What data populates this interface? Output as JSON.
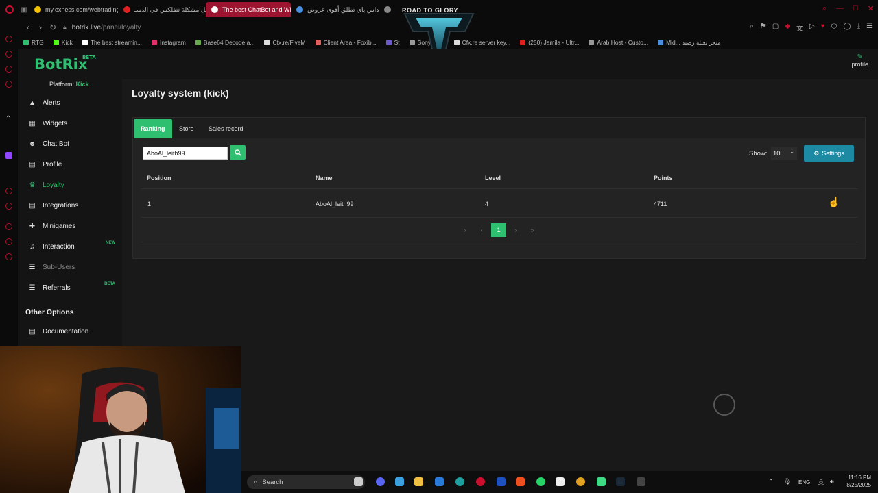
{
  "browser": {
    "tabs": [
      {
        "label": "my.exness.com/webtrading",
        "color": "#f5c400"
      },
      {
        "label": "حل مشكلة تتفلكس في الدسـ",
        "color": "#e02020"
      },
      {
        "label": "The best ChatBot and Wi",
        "color": "#ffffff",
        "active": true
      },
      {
        "label": "ميداس باي تطلق أقوى عروض",
        "color": "#4a90e2"
      },
      {
        "label": "",
        "color": "#888888"
      }
    ],
    "url_domain": "botrix.live",
    "url_path": "/panel/loyalty",
    "bookmarks": [
      {
        "label": "RTG",
        "color": "#2fbf71"
      },
      {
        "label": "Kick",
        "color": "#53fc18"
      },
      {
        "label": "The best streamin...",
        "color": "#ffffff"
      },
      {
        "label": "Instagram",
        "color": "#e1306c"
      },
      {
        "label": "Base64 Decode a...",
        "color": "#6aa84f"
      },
      {
        "label": "Cfx.re/FiveM",
        "color": "#dddddd"
      },
      {
        "label": "Client Area - Foxib...",
        "color": "#e06060"
      },
      {
        "label": "St",
        "color": "#6a5acd"
      },
      {
        "label": "Sony ZV...",
        "color": "#999999"
      },
      {
        "label": "Cfx.re server key...",
        "color": "#dddddd"
      },
      {
        "label": "(250) Jamila - Ultr...",
        "color": "#e02020"
      },
      {
        "label": "Arab Host - Custo...",
        "color": "#999999"
      },
      {
        "label": "Mid... متجر تعبئة رصيد",
        "color": "#4a90e2"
      }
    ]
  },
  "overlay": {
    "tag": "ROAD TO GLORY"
  },
  "app": {
    "logo": "BotRix",
    "logo_badge": "BETA",
    "profile_label": "profile",
    "platform_label": "Platform:",
    "platform_value": "Kick"
  },
  "sidebar": {
    "items": [
      {
        "label": "Alerts",
        "icon": "warning-icon",
        "glyph": "▲"
      },
      {
        "label": "Widgets",
        "icon": "grid-icon",
        "glyph": "▦"
      },
      {
        "label": "Chat Bot",
        "icon": "robot-icon",
        "glyph": "☻"
      },
      {
        "label": "Profile",
        "icon": "id-card-icon",
        "glyph": "▤"
      },
      {
        "label": "Loyalty",
        "icon": "trophy-icon",
        "glyph": "♛",
        "active": true
      },
      {
        "label": "Integrations",
        "icon": "list-icon",
        "glyph": "▤"
      },
      {
        "label": "Minigames",
        "icon": "gamepad-icon",
        "glyph": "✚"
      },
      {
        "label": "Interaction",
        "icon": "music-icon",
        "glyph": "♫",
        "badge": "NEW"
      },
      {
        "label": "Sub-Users",
        "icon": "users-icon",
        "glyph": "☰",
        "disabled": true
      },
      {
        "label": "Referrals",
        "icon": "users-icon",
        "glyph": "☰",
        "badge": "BETA"
      }
    ],
    "other_options": "Other Options",
    "documentation": "Documentation"
  },
  "page": {
    "title": "Loyalty system (kick)",
    "tabs": [
      "Ranking",
      "Store",
      "Sales record"
    ],
    "search_value": "AboAl_leith99",
    "show_label": "Show:",
    "show_value": "10",
    "settings_label": "Settings",
    "columns": [
      "Position",
      "Name",
      "Level",
      "Points"
    ],
    "rows": [
      {
        "position": "1",
        "name": "AboAl_leith99",
        "level": "4",
        "points": "4711"
      }
    ],
    "pagination": {
      "first": "«",
      "prev": "‹",
      "current": "1",
      "next": "›",
      "last": "»"
    }
  },
  "taskbar": {
    "search_placeholder": "Search",
    "lang": "ENG",
    "time": "11:16 PM",
    "date": "8/25/2025"
  }
}
